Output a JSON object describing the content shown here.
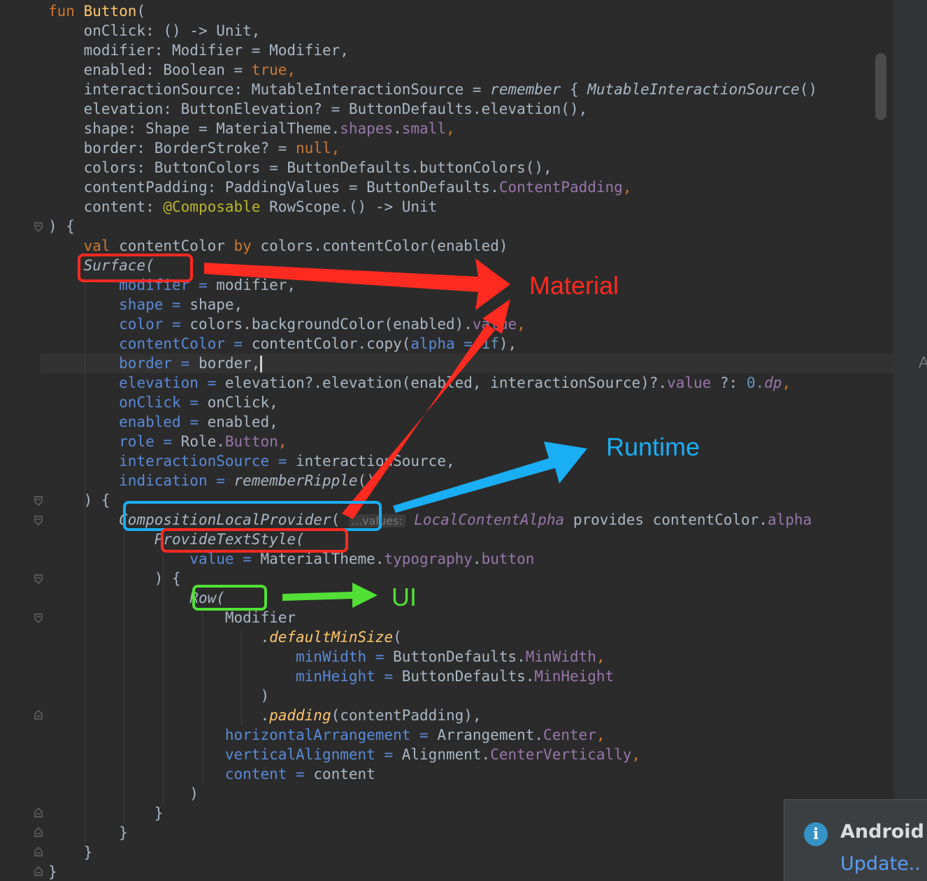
{
  "colors": {
    "background": "#2b2b2b",
    "keyword": "#cc7832",
    "function": "#ffc66d",
    "param_name": "#5a8ad8",
    "property": "#9876aa",
    "number": "#6897bb",
    "annotation": "#bbb529",
    "material_box": "#ff2a20",
    "runtime_box": "#1aaef5",
    "ui_box": "#52e036"
  },
  "code": {
    "l01": {
      "kw": "fun",
      "name": "Button",
      "paren": "("
    },
    "l02": "onClick: () -> Unit,",
    "l03": "modifier: Modifier = Modifier,",
    "l04": {
      "a": "enabled: Boolean = ",
      "b": "true",
      "c": ","
    },
    "l05": {
      "a": "interactionSource: MutableInteractionSource = ",
      "b": "remember",
      "c": " { ",
      "d": "MutableInteractionSource",
      "e": "()"
    },
    "l06": "elevation: ButtonElevation? = ButtonDefaults.elevation(),",
    "l07": {
      "a": "shape: Shape = MaterialTheme.",
      "b": "shapes",
      "c": ".",
      "d": "small",
      "e": ","
    },
    "l08": {
      "a": "border: BorderStroke? = ",
      "b": "null",
      "c": ","
    },
    "l09": "colors: ButtonColors = ButtonDefaults.buttonColors(),",
    "l10": {
      "a": "contentPadding: PaddingValues = ButtonDefaults.",
      "b": "ContentPadding",
      "c": ","
    },
    "l11": {
      "a": "content: ",
      "b": "@Composable",
      "c": " RowScope.() -> Unit"
    },
    "l12": ") {",
    "l13": {
      "kw": "val",
      "a": " contentColor ",
      "by": "by",
      "b": " colors.contentColor(enabled)"
    },
    "l14": "Surface(",
    "l15": {
      "p": "modifier",
      "eq": " = ",
      "v": "modifier,"
    },
    "l16": {
      "p": "shape",
      "eq": " = ",
      "v": "shape,"
    },
    "l17": {
      "p": "color",
      "eq": " = ",
      "v": "colors.backgroundColor(enabled).",
      "pr": "value",
      "end": ","
    },
    "l18": {
      "p": "contentColor",
      "eq": " = ",
      "v": "contentColor.copy(",
      "p2": "alpha",
      "eq2": " = ",
      "num": "1f",
      "end": "),"
    },
    "l19": {
      "p": "border",
      "eq": " = ",
      "v": "border,"
    },
    "l20": {
      "p": "elevation",
      "eq": " = ",
      "v": "elevation?.elevation(enabled, interactionSource)?.",
      "pr": "value",
      "v2": " ?: ",
      "num": "0.",
      "dp": "dp",
      "end": ","
    },
    "l21": {
      "p": "onClick",
      "eq": " = ",
      "v": "onClick,"
    },
    "l22": {
      "p": "enabled",
      "eq": " = ",
      "v": "enabled,"
    },
    "l23": {
      "p": "role",
      "eq": " = ",
      "v": "Role.",
      "pr": "Button",
      "end": ","
    },
    "l24": {
      "p": "interactionSource",
      "eq": " = ",
      "v": "interactionSource,"
    },
    "l25": {
      "p": "indication",
      "eq": " = ",
      "v": "rememberRipple",
      "end": "()"
    },
    "l26": ") {",
    "l27": {
      "fn": "CompositionLocalProvider",
      "paren": "(",
      "hint": "...values:",
      "it": "LocalContentAlpha",
      "rest": " provides contentColor.",
      "pr": "alpha"
    },
    "l28": "ProvideTextStyle(",
    "l29": {
      "p": "value",
      "eq": " = ",
      "v": "MaterialTheme.",
      "pr": "typography",
      "dot": ".",
      "pr2": "button"
    },
    "l30": ") {",
    "l31": "Row(",
    "l32": "Modifier",
    "l33": {
      "dot": ".",
      "fn": "defaultMinSize",
      "paren": "("
    },
    "l34": {
      "p": "minWidth",
      "eq": " = ",
      "v": "ButtonDefaults.",
      "pr": "MinWidth",
      "end": ","
    },
    "l35": {
      "p": "minHeight",
      "eq": " = ",
      "v": "ButtonDefaults.",
      "pr": "MinHeight"
    },
    "l36": ")",
    "l37": {
      "dot": ".",
      "fn": "padding",
      "v": "(contentPadding),"
    },
    "l38": {
      "p": "horizontalArrangement",
      "eq": " = ",
      "v": "Arrangement.",
      "pr": "Center",
      "end": ","
    },
    "l39": {
      "p": "verticalAlignment",
      "eq": " = ",
      "v": "Alignment.",
      "pr": "CenterVertically",
      "end": ","
    },
    "l40": {
      "p": "content",
      "eq": " = ",
      "v": "content"
    },
    "l41": ")",
    "l42": "}",
    "l43": "}",
    "l44": "}",
    "l45": "}"
  },
  "annotations": {
    "material": "Material",
    "runtime": "Runtime",
    "ui": "UI"
  },
  "notification": {
    "title": "Android",
    "link": "Update..",
    "icon": "info-icon"
  },
  "edge_glyph": "A"
}
